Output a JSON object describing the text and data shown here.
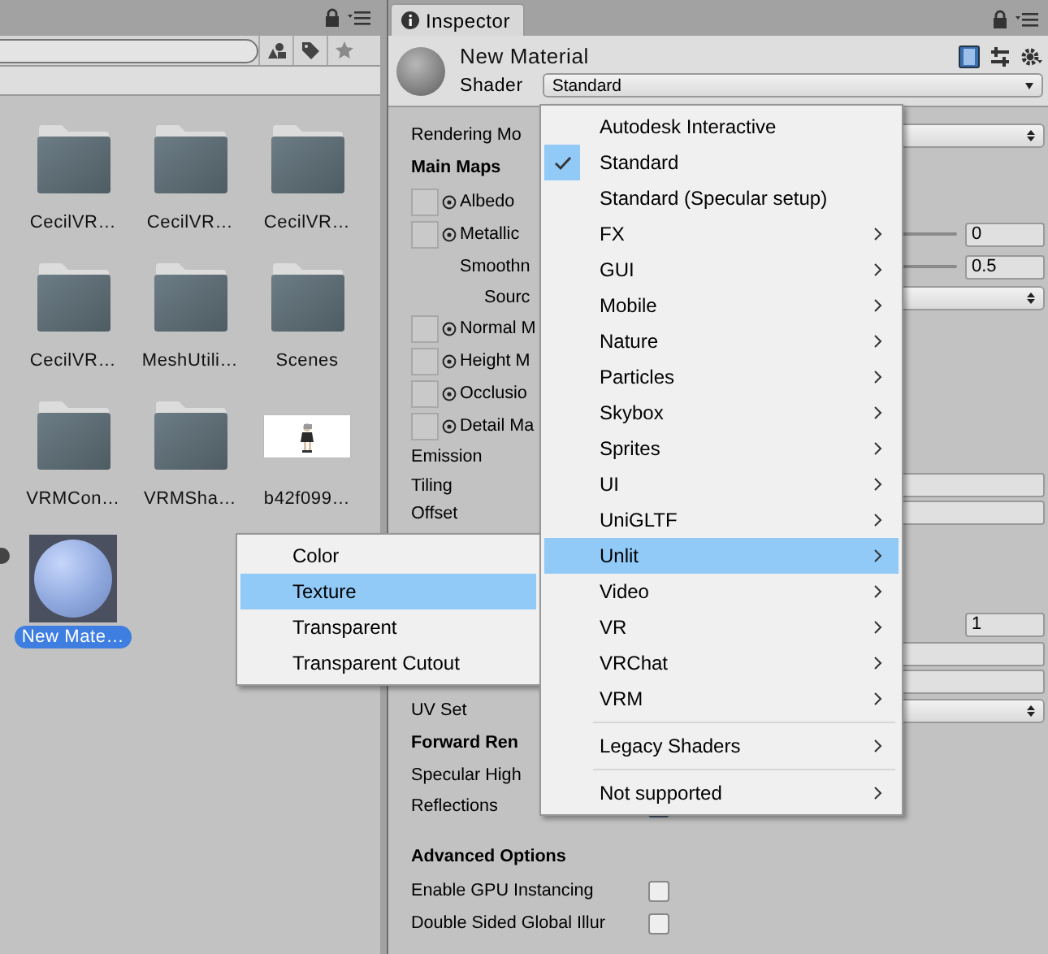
{
  "top_bar": {
    "tab": "Inspector"
  },
  "project": {
    "items": [
      {
        "kind": "folder",
        "label": "CecilVR…",
        "selected": false
      },
      {
        "kind": "folder",
        "label": "CecilVR…",
        "selected": false
      },
      {
        "kind": "folder",
        "label": "CecilVR…",
        "selected": false
      },
      {
        "kind": "folder",
        "label": "CecilVR…",
        "selected": false
      },
      {
        "kind": "folder",
        "label": "MeshUtili…",
        "selected": false
      },
      {
        "kind": "folder",
        "label": "Scenes",
        "selected": false
      },
      {
        "kind": "folder",
        "label": "VRMCon…",
        "selected": false
      },
      {
        "kind": "folder",
        "label": "VRMSha…",
        "selected": false
      },
      {
        "kind": "picture",
        "label": "b42f099…",
        "selected": false
      },
      {
        "kind": "material",
        "label": "New Mate…",
        "selected": true
      }
    ]
  },
  "inspector": {
    "title": "New Material",
    "shader_label": "Shader",
    "shader": "Standard",
    "rows": [
      {
        "kind": "property",
        "label": "Rendering Mo",
        "control": {
          "kind": "dropdown"
        }
      },
      {
        "kind": "header",
        "label": "Main Maps"
      },
      {
        "kind": "texture",
        "label": "Albedo"
      },
      {
        "kind": "texture",
        "label": "Metallic",
        "control": {
          "kind": "slider",
          "value": "0"
        },
        "children": [
          {
            "kind": "property",
            "label": "Smoothn",
            "control": {
              "kind": "slider",
              "value": "0.5"
            },
            "children": [
              {
                "kind": "property",
                "label": "Sourc",
                "control": {
                  "kind": "dropdown"
                }
              }
            ]
          }
        ]
      },
      {
        "kind": "texture",
        "label": "Normal M"
      },
      {
        "kind": "texture",
        "label": "Height M"
      },
      {
        "kind": "texture",
        "label": "Occlusio"
      },
      {
        "kind": "texture",
        "label": "Detail Ma"
      },
      {
        "kind": "property",
        "label": "Emission"
      },
      {
        "kind": "property",
        "label": "Tiling",
        "control": {
          "kind": "field"
        }
      },
      {
        "kind": "property",
        "label": "Offset",
        "control": {
          "kind": "field"
        }
      },
      {
        "kind": "property",
        "control": {
          "kind": "short-field",
          "value": "1"
        },
        "gap_before": true
      },
      {
        "kind": "property",
        "control": {
          "kind": "field"
        }
      },
      {
        "kind": "property",
        "control": {
          "kind": "field"
        }
      },
      {
        "kind": "property",
        "label": "UV Set",
        "control": {
          "kind": "dropdown"
        }
      },
      {
        "kind": "header",
        "label": "Forward Ren"
      },
      {
        "kind": "property",
        "label": "Specular High"
      },
      {
        "kind": "property",
        "label": "Reflections",
        "control": {
          "kind": "checkbox",
          "checked": true
        }
      },
      {
        "kind": "header",
        "label": "Advanced Options",
        "gap_before": true
      },
      {
        "kind": "property",
        "label": "Enable GPU Instancing",
        "control": {
          "kind": "checkbox",
          "checked": false
        }
      },
      {
        "kind": "property",
        "label": "Double Sided Global Illur",
        "control": {
          "kind": "checkbox",
          "checked": false
        }
      }
    ]
  },
  "shader_menu": {
    "sections": [
      {
        "items": [
          {
            "label": "Autodesk Interactive",
            "checked": false,
            "selected": false,
            "submenu": false
          },
          {
            "label": "Standard",
            "checked": true,
            "selected": false,
            "submenu": false
          },
          {
            "label": "Standard (Specular setup)",
            "checked": false,
            "selected": false,
            "submenu": false
          },
          {
            "label": "FX",
            "checked": false,
            "selected": false,
            "submenu": true
          },
          {
            "label": "GUI",
            "checked": false,
            "selected": false,
            "submenu": true
          },
          {
            "label": "Mobile",
            "checked": false,
            "selected": false,
            "submenu": true
          },
          {
            "label": "Nature",
            "checked": false,
            "selected": false,
            "submenu": true
          },
          {
            "label": "Particles",
            "checked": false,
            "selected": false,
            "submenu": true
          },
          {
            "label": "Skybox",
            "checked": false,
            "selected": false,
            "submenu": true
          },
          {
            "label": "Sprites",
            "checked": false,
            "selected": false,
            "submenu": true
          },
          {
            "label": "UI",
            "checked": false,
            "selected": false,
            "submenu": true
          },
          {
            "label": "UniGLTF",
            "checked": false,
            "selected": false,
            "submenu": true
          },
          {
            "label": "Unlit",
            "checked": false,
            "selected": true,
            "submenu": true
          },
          {
            "label": "Video",
            "checked": false,
            "selected": false,
            "submenu": true
          },
          {
            "label": "VR",
            "checked": false,
            "selected": false,
            "submenu": true
          },
          {
            "label": "VRChat",
            "checked": false,
            "selected": false,
            "submenu": true
          },
          {
            "label": "VRM",
            "checked": false,
            "selected": false,
            "submenu": true
          }
        ]
      },
      {
        "items": [
          {
            "label": "Legacy Shaders",
            "checked": false,
            "selected": false,
            "submenu": true
          }
        ]
      },
      {
        "items": [
          {
            "label": "Not supported",
            "checked": false,
            "selected": false,
            "submenu": true
          }
        ]
      }
    ]
  },
  "submenu": {
    "items": [
      {
        "label": "Color",
        "selected": false
      },
      {
        "label": "Texture",
        "selected": true
      },
      {
        "label": "Transparent",
        "selected": false
      },
      {
        "label": "Transparent Cutout",
        "selected": false
      }
    ]
  }
}
